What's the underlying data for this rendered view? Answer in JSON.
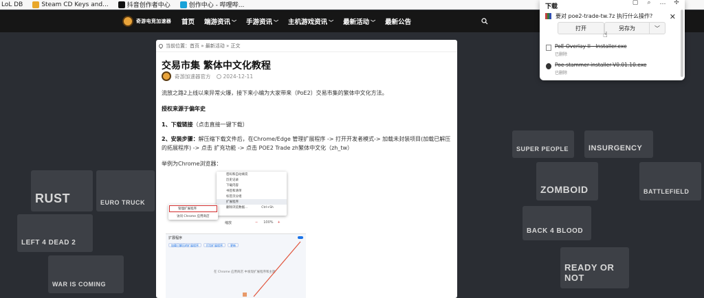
{
  "bookmarks": [
    {
      "label": "LoL DB",
      "color": "#ffffff"
    },
    {
      "label": "Steam CD Keys and...",
      "color": "#e9a72a"
    },
    {
      "label": "抖音创作者中心",
      "color": "#111111"
    },
    {
      "label": "创作中心 - 哔哩哔...",
      "color": "#19a2d8"
    }
  ],
  "site": {
    "logo_text": "奇游电竞加速器",
    "nav": [
      {
        "label": "首页",
        "has_dropdown": false
      },
      {
        "label": "端游资讯",
        "has_dropdown": true
      },
      {
        "label": "手游资讯",
        "has_dropdown": true
      },
      {
        "label": "主机游戏资讯",
        "has_dropdown": true
      },
      {
        "label": "最新活动",
        "has_dropdown": true
      },
      {
        "label": "最新公告",
        "has_dropdown": false
      }
    ]
  },
  "background_games": [
    "RUST",
    "EURO TRUCK",
    "LEFT 4 DEAD 2",
    "WAR IS COMING",
    "SUPER PEOPLE",
    "ZOMBOID",
    "INSURGENCY",
    "BATTLEFIELD",
    "BACK 4 BLOOD",
    "READY OR NOT"
  ],
  "article": {
    "breadcrumb": "当前位置：首页 » 最新活动 » 正文",
    "title": "交易市集 繁体中文化教程",
    "author": "奇游加速器官方",
    "date": "2024-12-11",
    "intro": "流放之路2上线以来异常火爆，接下来小编为大家带来（PoE2）交易市集的繁体中文化方法。",
    "source": "授权来源于偏年史",
    "step1_label": "1、下载链接",
    "step1_text": "（点击直接一键下载）",
    "step2_label": "2、安装步骤：",
    "step2_text": "解压缩下载文件后，在Chrome/Edge 管理扩展程序 -> 打开开发者模式-> 加载未封装项目(加载已解压的拓展程序) -> 点击 扩充功能 -> 点击 POE2 Trade zh繁体中文化（zh_tw）",
    "example": "举例为Chrome浏览器：",
    "screenshot": {
      "menu_rows": [
        "密码和自动填充",
        "历史记录",
        "下载内容",
        "书签和清单",
        "标签页分组",
        "扩展程序",
        "删除浏览数据...",
        ""
      ],
      "menu_shortcut": "Ctrl+Sh",
      "submenu_rows": [
        "管理扩展程序",
        "访问 Chrome 应用商店"
      ],
      "zoom_label": "缩放",
      "zoom_value": "100%",
      "ext_title": "扩展程序",
      "ext_buttons": [
        "加载已解压的扩展程序",
        "打包扩展程序",
        "更新"
      ],
      "ext_hint": "在 Chrome 应用商店 中发现扩展程序和主题"
    }
  },
  "downloads": {
    "title": "下载",
    "prompt": "要对 poe2-trade-tw.7z 执行什么操作?",
    "open_label": "打开",
    "save_as_label": "另存为",
    "files": [
      {
        "name": "PoE Overlay II - Installer.exe",
        "status": "已删除"
      },
      {
        "name": "Poe-stammer-installer-V0.01.10.exe",
        "status": "已删除"
      }
    ]
  }
}
